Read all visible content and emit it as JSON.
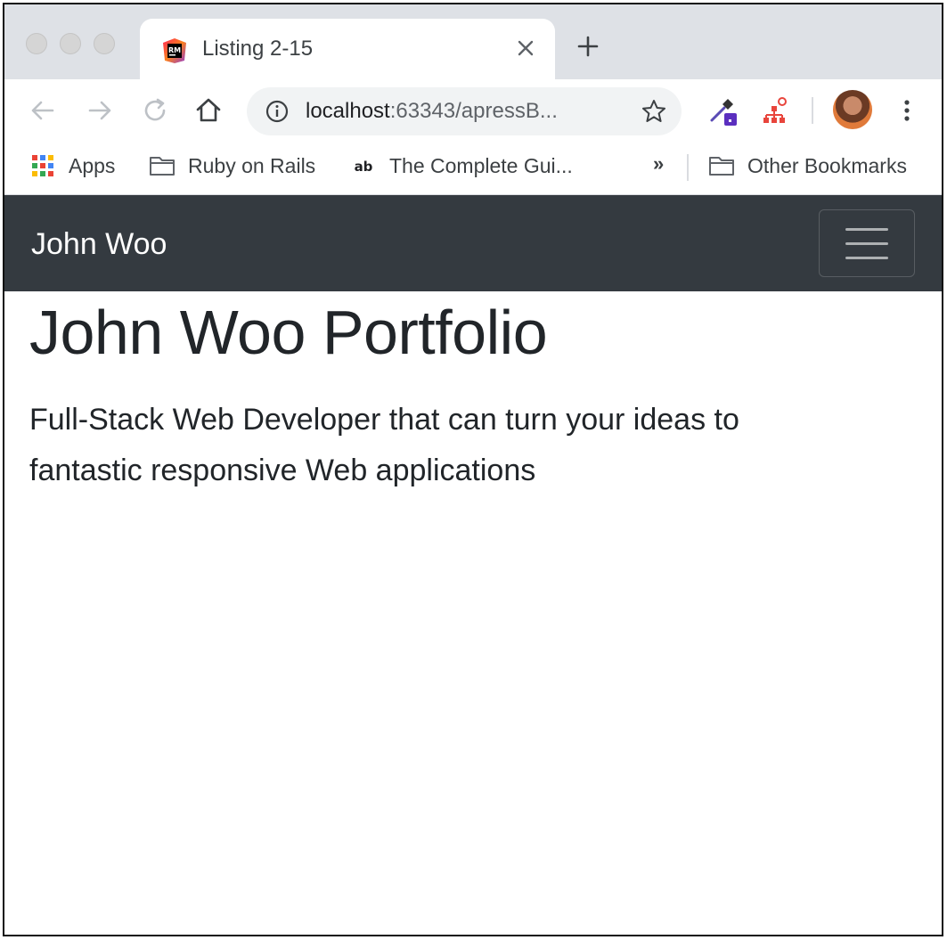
{
  "browser": {
    "tab": {
      "title": "Listing 2-15",
      "favicon_text": "RM"
    },
    "address_bar": {
      "host": "localhost",
      "rest": ":63343/apressB..."
    },
    "bookmarks": [
      {
        "label": "Apps",
        "icon": "apps-grid-icon"
      },
      {
        "label": "Ruby on Rails",
        "icon": "folder-icon"
      },
      {
        "label": "The Complete Gui...",
        "icon": "ab-icon"
      }
    ],
    "bookmarks_more": "»",
    "other_bookmarks": "Other Bookmarks"
  },
  "page": {
    "navbar": {
      "brand": "John Woo"
    },
    "jumbotron": {
      "title": "John Woo Portfolio",
      "lead": "Full-Stack Web Developer that can turn your ideas to fantastic responsive Web applications"
    }
  },
  "colors": {
    "navbar_bg": "#343a40",
    "text": "#212529",
    "tabstrip_bg": "#dee1e6"
  }
}
